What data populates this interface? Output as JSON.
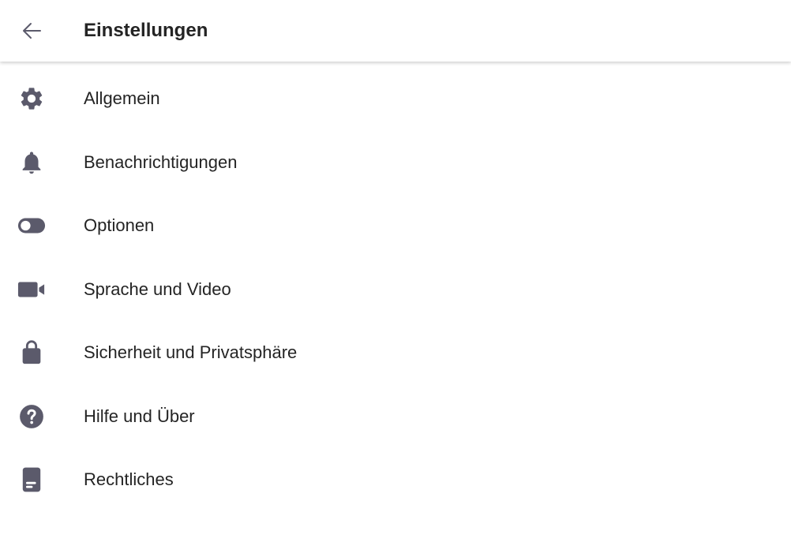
{
  "header": {
    "title": "Einstellungen",
    "back_icon": "arrow-left-icon"
  },
  "colors": {
    "icon": "#5b5a6b",
    "text": "#242424",
    "background": "#ffffff"
  },
  "settings": {
    "items": [
      {
        "label": "Allgemein",
        "icon": "gear-icon"
      },
      {
        "label": "Benachrichtigungen",
        "icon": "bell-icon"
      },
      {
        "label": "Optionen",
        "icon": "toggle-icon"
      },
      {
        "label": "Sprache und Video",
        "icon": "video-camera-icon"
      },
      {
        "label": "Sicherheit und Privatsphäre",
        "icon": "lock-icon"
      },
      {
        "label": "Hilfe und Über",
        "icon": "help-icon"
      },
      {
        "label": "Rechtliches",
        "icon": "document-icon"
      }
    ]
  }
}
